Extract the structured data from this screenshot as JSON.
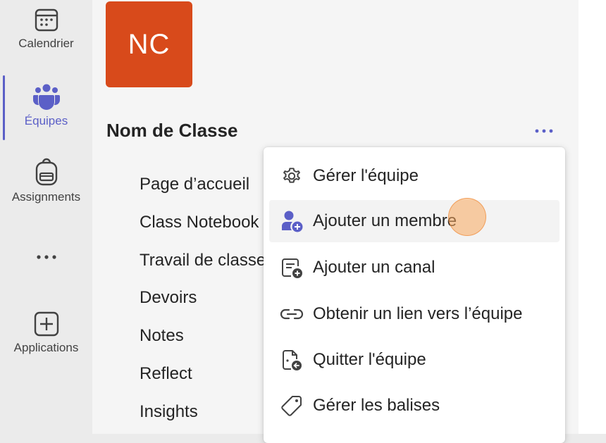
{
  "rail": {
    "items": [
      {
        "label": "Calendrier",
        "icon": "calendar-icon"
      },
      {
        "label": "Équipes",
        "icon": "teams-icon",
        "active": true
      },
      {
        "label": "Assignments",
        "icon": "backpack-icon"
      },
      {
        "label": "",
        "icon": "more-icon"
      },
      {
        "label": "Applications",
        "icon": "add-app-icon"
      }
    ]
  },
  "team": {
    "avatar_initials": "NC",
    "avatar_color": "#d84a1b",
    "name": "Nom de Classe",
    "channels": [
      "Page d’accueil",
      "Class Notebook",
      "Travail de classe",
      "Devoirs",
      "Notes",
      "Reflect",
      "Insights"
    ]
  },
  "menu": {
    "items": [
      {
        "label": "Gérer l'équipe",
        "icon": "gear-icon"
      },
      {
        "label": "Ajouter un membre",
        "icon": "add-person-icon",
        "hovered": true
      },
      {
        "label": "Ajouter un canal",
        "icon": "add-channel-icon"
      },
      {
        "label": "Obtenir un lien vers l’équipe",
        "icon": "link-icon"
      },
      {
        "label": "Quitter l'équipe",
        "icon": "leave-icon"
      },
      {
        "label": "Gérer les balises",
        "icon": "tag-icon"
      }
    ]
  },
  "colors": {
    "accent": "#5b5fc7",
    "brand_orange": "#d84a1b"
  }
}
